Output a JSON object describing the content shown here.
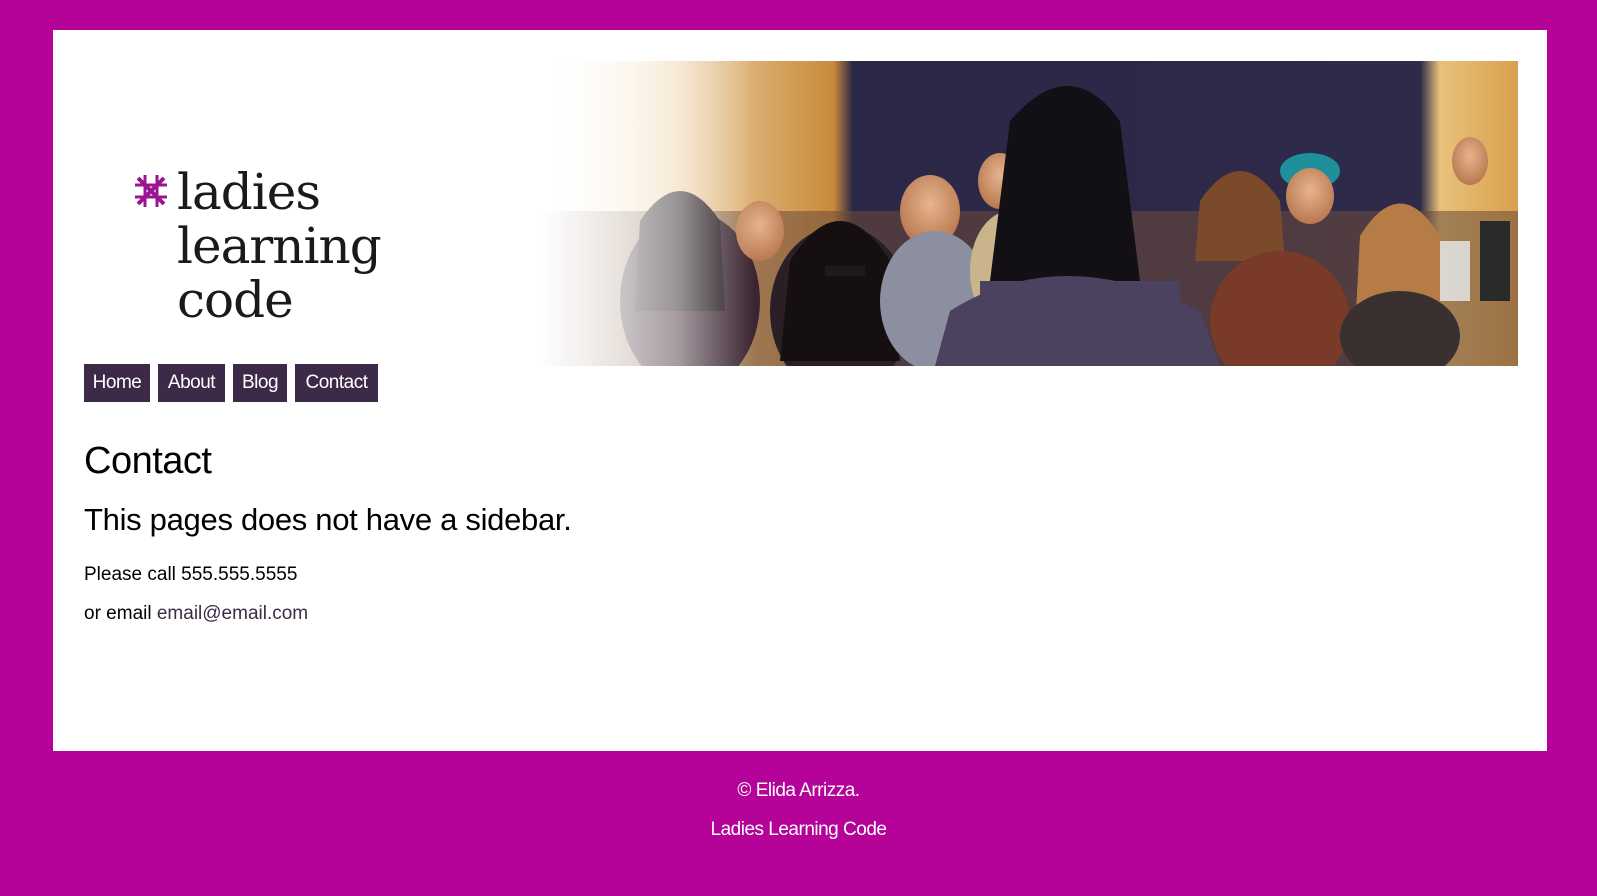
{
  "colors": {
    "background": "#b5039a",
    "page": "#ffffff",
    "nav_button": "#3d2a48",
    "nav_text": "#ffffff",
    "footer_text": "#ffffff"
  },
  "logo": {
    "icon": "asterisk-cross-icon",
    "line1": "ladies",
    "line2": "learning",
    "line3": "code"
  },
  "hero": {
    "icon": "classroom-photo"
  },
  "nav": {
    "items": [
      {
        "label": "Home"
      },
      {
        "label": "About"
      },
      {
        "label": "Blog"
      },
      {
        "label": "Contact"
      }
    ]
  },
  "main": {
    "title": "Contact",
    "subtitle": "This pages does not have a sidebar.",
    "phone_prefix": "Please call",
    "phone": "555.555.5555",
    "email_prefix": "or email",
    "email": "email@email.com"
  },
  "footer": {
    "copyright": "© Elida Arrizza.",
    "site_name": "Ladies Learning Code"
  }
}
